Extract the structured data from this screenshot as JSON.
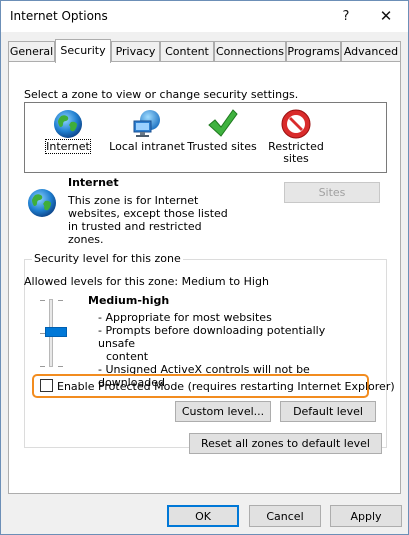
{
  "window": {
    "title": "Internet Options",
    "help_glyph": "?",
    "close_glyph": "✕"
  },
  "tabs": [
    {
      "label": "General"
    },
    {
      "label": "Security"
    },
    {
      "label": "Privacy"
    },
    {
      "label": "Content"
    },
    {
      "label": "Connections"
    },
    {
      "label": "Programs"
    },
    {
      "label": "Advanced"
    }
  ],
  "zones": {
    "prompt": "Select a zone to view or change security settings.",
    "items": [
      {
        "label": "Internet",
        "icon": "globe-icon"
      },
      {
        "label": "Local intranet",
        "icon": "network-computer-icon"
      },
      {
        "label": "Trusted sites",
        "icon": "checkmark-icon"
      },
      {
        "label_line1": "Restricted",
        "label_line2": "sites",
        "icon": "prohibited-icon"
      }
    ]
  },
  "selected_zone": {
    "title": "Internet",
    "description": "This zone is for Internet websites, except those listed in trusted and restricted zones.",
    "sites_button": "Sites"
  },
  "security_level": {
    "group_label": "Security level for this zone",
    "allowed_levels": "Allowed levels for this zone: Medium to High",
    "level_name": "Medium-high",
    "points": [
      "- Appropriate for most websites",
      "- Prompts before downloading potentially unsafe",
      "content",
      "- Unsigned ActiveX controls will not be downloaded"
    ],
    "slider_level_fraction": 0.5
  },
  "protected_mode": {
    "label": "Enable Protected Mode (requires restarting Internet Explorer)",
    "checked": false,
    "highlight_color": "#f28c1f"
  },
  "buttons": {
    "custom_level": "Custom level...",
    "default_level": "Default level",
    "reset_all": "Reset all zones to default level",
    "ok": "OK",
    "cancel": "Cancel",
    "apply": "Apply"
  },
  "colors": {
    "accent": "#0078d7",
    "highlight": "#f28c1f"
  }
}
